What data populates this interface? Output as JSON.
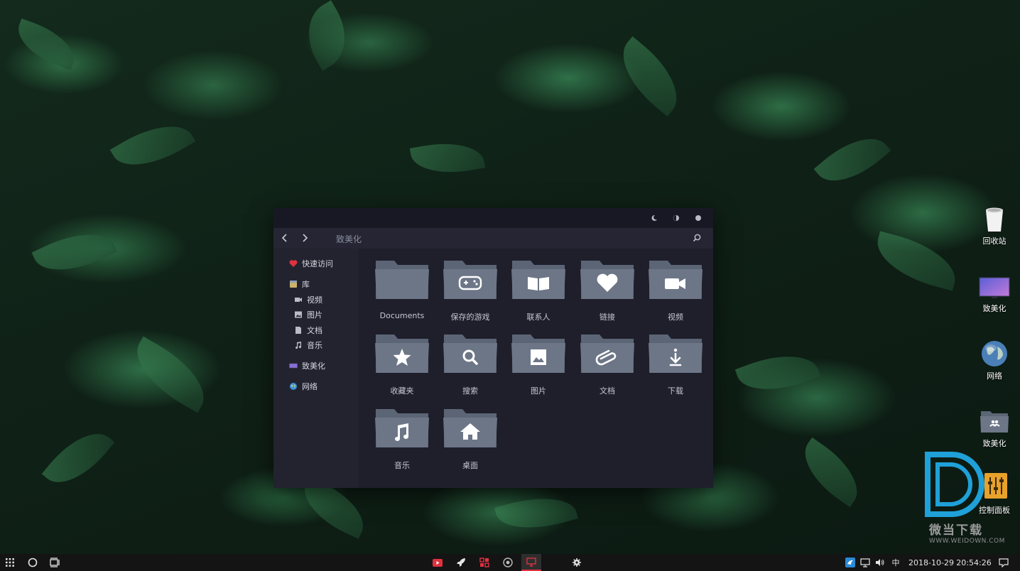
{
  "window": {
    "address": "致美化",
    "sidebar": {
      "quick_access": "快速访问",
      "library": "库",
      "videos": "视频",
      "pictures": "图片",
      "documents": "文档",
      "music": "音乐",
      "zhimeihua": "致美化",
      "network": "网络"
    },
    "folders": [
      {
        "label": "Documents",
        "icon": "blank-folder-icon"
      },
      {
        "label": "保存的游戏",
        "icon": "gamepad-icon"
      },
      {
        "label": "联系人",
        "icon": "book-icon"
      },
      {
        "label": "链接",
        "icon": "heart-icon"
      },
      {
        "label": "视频",
        "icon": "video-camera-icon"
      },
      {
        "label": "收藏夹",
        "icon": "star-icon"
      },
      {
        "label": "搜索",
        "icon": "magnifier-icon"
      },
      {
        "label": "图片",
        "icon": "image-icon"
      },
      {
        "label": "文档",
        "icon": "paperclip-icon"
      },
      {
        "label": "下载",
        "icon": "download-icon"
      },
      {
        "label": "音乐",
        "icon": "music-note-icon"
      },
      {
        "label": "桌面",
        "icon": "home-icon"
      }
    ]
  },
  "desktop": {
    "recycle_bin": "回收站",
    "zhimeihua_monitor": "致美化",
    "network": "网络",
    "zhimeihua_folder": "致美化",
    "control_panel": "控制面板"
  },
  "watermark": {
    "text": "微当下载",
    "url": "WWW.WEIDOWN.COM"
  },
  "taskbar": {
    "ime": "中",
    "date": "2018-10-29",
    "time": "20:54:26"
  },
  "colors": {
    "folder": "#6d7687",
    "folder_tab": "#5c6575",
    "window_bg": "#1f1f2c",
    "accent_red": "#e0313f"
  }
}
